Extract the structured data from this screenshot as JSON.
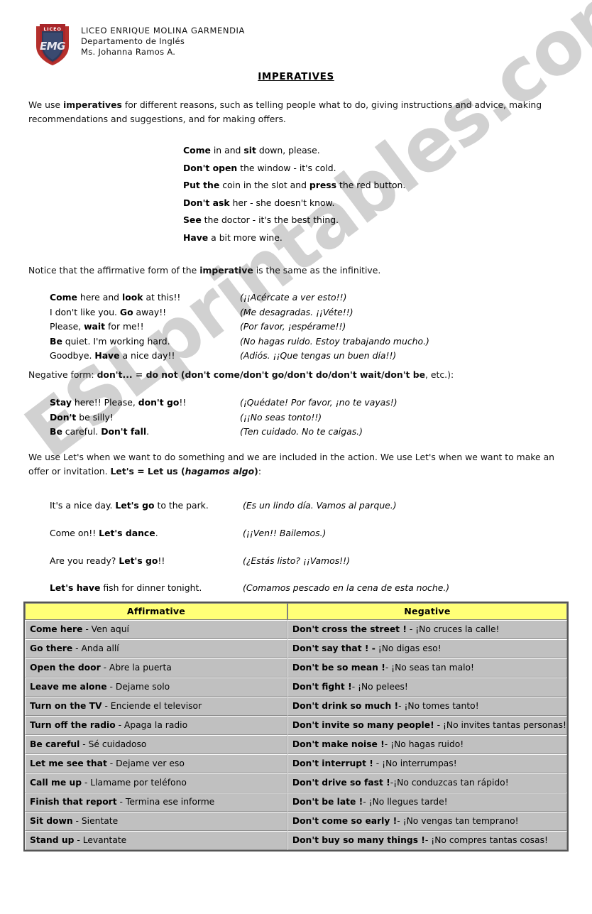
{
  "watermark": {
    "text": "ESLprintables.com"
  },
  "header": {
    "logo_name": "liceo-crest-logo",
    "school_name": "LICEO ENRIQUE MOLINA GARMENDIA",
    "department": "Departamento de Inglés",
    "teacher": "Ms. Johanna Ramos A."
  },
  "title": "IMPERATIVES",
  "intro": {
    "part1": "We use ",
    "bold1": "imperatives",
    "part2": " for different reasons, such as telling people what to do, giving instructions and advice, making recommendations and suggestions, and for making offers."
  },
  "examples_1": [
    {
      "bold": "Come",
      "rest": " in and ",
      "bold2": "sit",
      "rest2": " down, please."
    },
    {
      "bold": "Don't open",
      "rest": " the window - it's cold."
    },
    {
      "bold": "Put the",
      "rest": " coin in the slot and ",
      "bold2": "press",
      "rest2": " the red button."
    },
    {
      "bold": "Don't ask",
      "rest": " her - she doesn't know."
    },
    {
      "bold": "See",
      "rest": " the doctor - it's the best thing."
    },
    {
      "bold": "Have",
      "rest": " a bit more wine."
    }
  ],
  "notice": {
    "part1": "Notice that the affirmative form of the ",
    "bold1": "imperative",
    "part2": " is the same as the infinitive."
  },
  "examples_2": [
    {
      "en_pre": "",
      "en_bold": "Come",
      "en_mid": " here and ",
      "en_bold2": "look",
      "en_post": " at this!!",
      "es": "(¡¡Acércate a ver esto!!)"
    },
    {
      "en_pre": "I don't like you. ",
      "en_bold": "Go",
      "en_mid": " away!!",
      "en_bold2": "",
      "en_post": "",
      "es": "(Me desagradas. ¡¡Véte!!)"
    },
    {
      "en_pre": "Please, ",
      "en_bold": "wait",
      "en_mid": " for me!!",
      "en_bold2": "",
      "en_post": "",
      "es": "(Por favor, ¡espérame!!)"
    },
    {
      "en_pre": "",
      "en_bold": "Be",
      "en_mid": " quiet. I'm working hard.",
      "en_bold2": "",
      "en_post": "",
      "es": " (No hagas ruido. Estoy trabajando mucho.)"
    },
    {
      "en_pre": "Goodbye. ",
      "en_bold": "Have",
      "en_mid": " a nice day!!",
      "en_bold2": "",
      "en_post": "",
      "es": "(Adiós. ¡¡Que tengas un buen día!!)"
    }
  ],
  "negative_intro": {
    "part1": "Negative form: ",
    "bold1": "don't... = do not (don't come/don't go/don't do/don't wait/don't be",
    "part2": ", etc.):"
  },
  "examples_3": [
    {
      "en_pre": "",
      "en_bold": "Stay",
      "en_mid": " here!! Please, ",
      "en_bold2": "don't go",
      "en_post": "!!",
      "es": "(¡Quédate! Por favor, ¡no te vayas!)"
    },
    {
      "en_pre": "",
      "en_bold": "Don't",
      "en_mid": " be silly!",
      "en_bold2": "",
      "en_post": "",
      "es": " (¡¡No seas tonto!!)"
    },
    {
      "en_pre": "",
      "en_bold": "Be",
      "en_mid": " careful. ",
      "en_bold2": "Don't fall",
      "en_post": ".",
      "es": "(Ten cuidado. No te caigas.)"
    }
  ],
  "lets_intro": {
    "part1": "We use Let's when we want to do something and we are included in the action. We use Let's when we want to make an offer or invitation. ",
    "bold1": "Let's  =  Let us (",
    "bold_italic": "hagamos algo",
    "bold2": ")",
    "part2": ":"
  },
  "examples_4": [
    {
      "en_pre": "It's a nice day. ",
      "en_bold": "Let's go",
      "en_mid": " to the park.",
      "es": "(Es un lindo día. Vamos al parque.)"
    },
    {
      "en_pre": "Come on!! ",
      "en_bold": "Let's dance",
      "en_mid": ".",
      "es": "(¡¡Ven!! Bailemos.)"
    },
    {
      "en_pre": "Are you ready? ",
      "en_bold": "Let's go",
      "en_mid": "!!",
      "es": "(¿Estás listo? ¡¡Vamos!!)"
    },
    {
      "en_pre": "",
      "en_bold": "Let's have",
      "en_mid": " fish for dinner tonight.",
      "es": "(Comamos pescado en la cena de esta noche.)"
    }
  ],
  "table": {
    "headers": [
      "Affirmative",
      "Negative"
    ],
    "rows": [
      {
        "aff_bold": "Come here",
        "aff_rest": " - Ven aquí",
        "neg_bold": "Don't cross the street !",
        "neg_rest": " - ¡No cruces la calle!"
      },
      {
        "aff_bold": "Go there",
        "aff_rest": " - Anda allí",
        "neg_bold": "Don't say that ! -",
        "neg_rest": " ¡No digas eso!"
      },
      {
        "aff_bold": "Open the door",
        "aff_rest": " - Abre la puerta",
        "neg_bold": "Don't be so mean !",
        "neg_rest": "- ¡No seas tan malo!"
      },
      {
        "aff_bold": "Leave me alone",
        "aff_rest": " - Dejame solo",
        "neg_bold": "Don't fight !",
        "neg_rest": "- ¡No pelees!"
      },
      {
        "aff_bold": "Turn on the TV",
        "aff_rest": " - Enciende el televisor",
        "neg_bold": "Don't drink so much !",
        "neg_rest": "- ¡No tomes tanto!"
      },
      {
        "aff_bold": "Turn off the radio",
        "aff_rest": " - Apaga la radio",
        "neg_bold": "Don't invite so many people!",
        "neg_rest": " - ¡No invites tantas personas!"
      },
      {
        "aff_bold": "Be careful",
        "aff_rest": " - Sé cuidadoso",
        "neg_bold": "Don't make noise !",
        "neg_rest": "- ¡No hagas ruido!"
      },
      {
        "aff_bold": "Let me see that",
        "aff_rest": " - Dejame ver eso",
        "neg_bold": "Don't interrupt !",
        "neg_rest": " - ¡No interrumpas!"
      },
      {
        "aff_bold": "Call me up",
        "aff_rest": " - Llamame por teléfono",
        "neg_bold": "Don't drive so fast !",
        "neg_rest": "-¡No conduzcas tan rápido!"
      },
      {
        "aff_bold": "Finish that report",
        "aff_rest": " - Termina ese informe",
        "neg_bold": "Don't be late !",
        "neg_rest": "- ¡No llegues tarde!"
      },
      {
        "aff_bold": "Sit down",
        "aff_rest": " - Sientate",
        "neg_bold": "Don't come so early !",
        "neg_rest": "- ¡No vengas tan temprano!"
      },
      {
        "aff_bold": "Stand up",
        "aff_rest": " - Levantate",
        "neg_bold": "Don't buy so many things !",
        "neg_rest": "- ¡No compres tantas cosas!"
      }
    ]
  },
  "colors": {
    "header_yellow": "#ffff77",
    "row_gray": "#c0c0c0",
    "watermark_gray": "#cfcfcf",
    "crest_red": "#b5302c",
    "crest_navy": "#2e3b5c"
  }
}
